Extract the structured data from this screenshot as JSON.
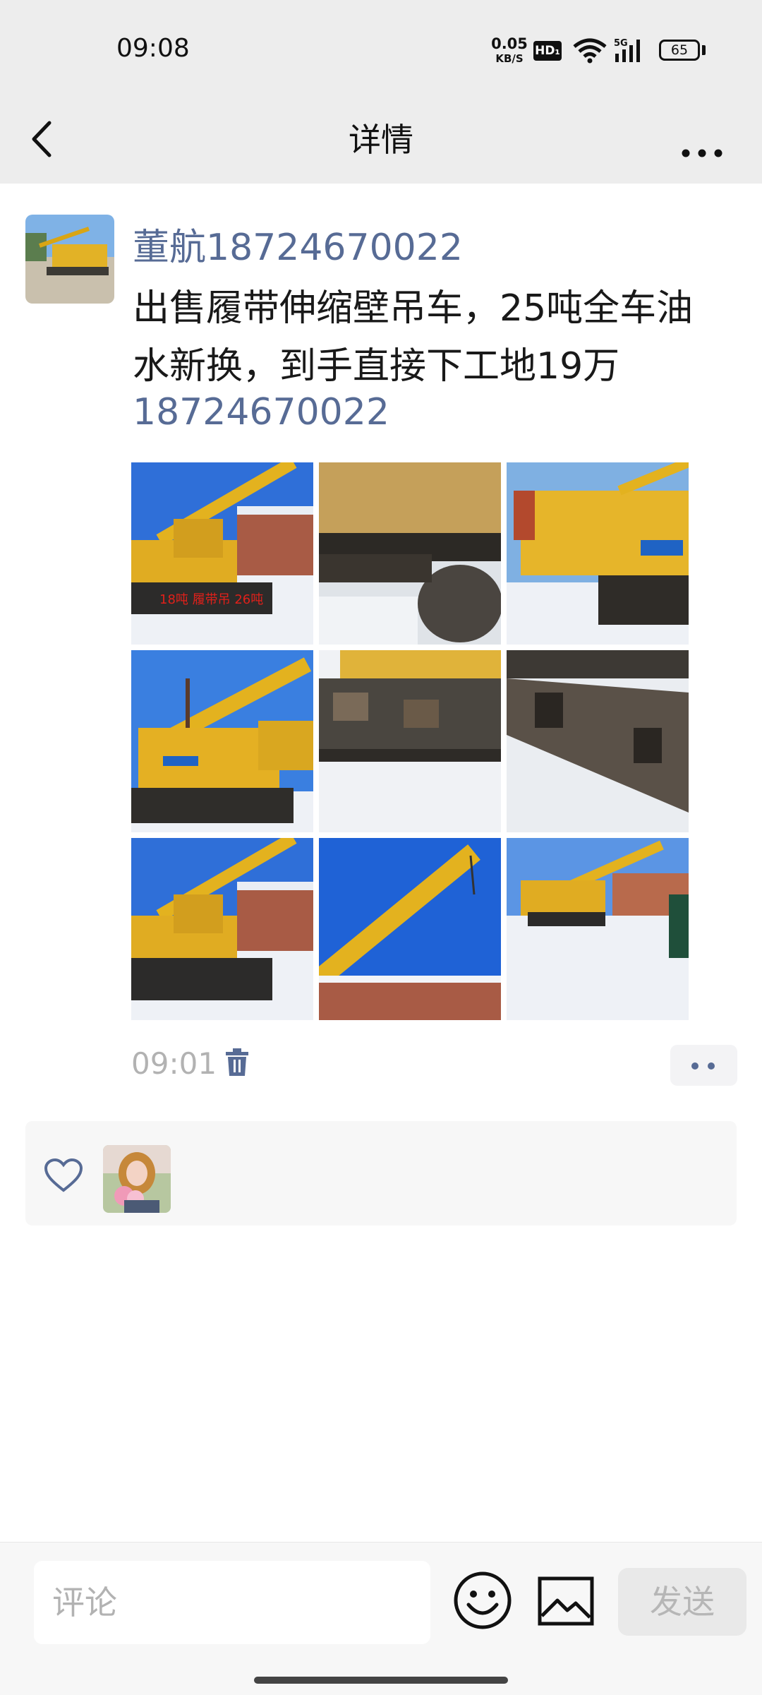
{
  "status_bar": {
    "time": "09:08",
    "net_speed": "0.05",
    "net_unit": "KB/S",
    "hd": "HD₁",
    "network": "5G",
    "battery": "65"
  },
  "nav": {
    "title": "详情",
    "back_icon": "chevron-left-icon",
    "more_icon": "more-horizontal-icon"
  },
  "post": {
    "author": "董航18724670022",
    "text": "出售履带伸缩壁吊车，25吨全车油水新换，到手直接下工地19万",
    "phone": "18724670022",
    "time": "09:01",
    "photos": [
      {
        "desc": "yellow crawler crane in snow, side view with watermark"
      },
      {
        "desc": "underside of crane body and track"
      },
      {
        "desc": "XCMG crane rear counterweight"
      },
      {
        "desc": "crane cab and boom, XCMG logo"
      },
      {
        "desc": "rusty track frame in snow"
      },
      {
        "desc": "close-up of track frame"
      },
      {
        "desc": "crane side view in snow"
      },
      {
        "desc": "extended telescopic boom against blue sky"
      },
      {
        "desc": "crane in snowy street"
      }
    ],
    "watermark": "18吨 履带吊 26吨"
  },
  "likes": {
    "heart_icon": "heart-outline-icon"
  },
  "composer": {
    "placeholder": "评论",
    "send_label": "发送",
    "emoji_icon": "smiley-icon",
    "image_icon": "image-icon"
  },
  "colors": {
    "link": "#576b95",
    "bar_bg": "#ededed",
    "crane_yellow": "#e8b620",
    "sky_blue": "#2a6fd6"
  }
}
